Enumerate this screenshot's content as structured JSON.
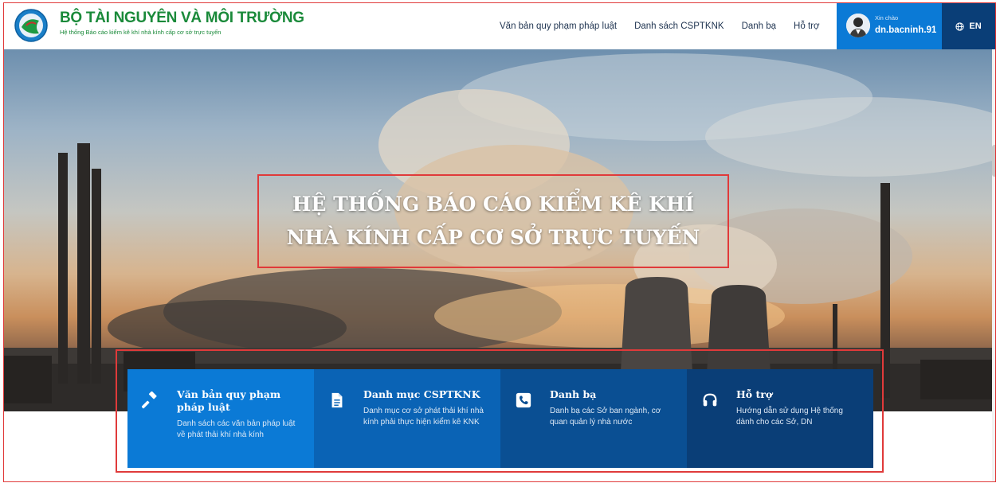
{
  "header": {
    "brand_title": "BỘ TÀI NGUYÊN VÀ MÔI TRƯỜNG",
    "brand_subtitle": "Hệ thống Báo cáo kiểm kê khí nhà kính cấp cơ sở trực tuyến",
    "nav": [
      {
        "label": "Văn bản quy phạm pháp luật"
      },
      {
        "label": "Danh sách CSPTKNK"
      },
      {
        "label": "Danh bạ"
      },
      {
        "label": "Hỗ trợ"
      }
    ],
    "user": {
      "greeting": "Xin chào",
      "name": "dn.bacninh.91"
    },
    "language": "EN"
  },
  "hero": {
    "title": "HỆ THỐNG BÁO CÁO KIỂM KÊ KHÍ NHÀ KÍNH CẤP CƠ SỞ TRỰC TUYẾN"
  },
  "cards": [
    {
      "icon": "gavel-icon",
      "title": "Văn bản quy phạm pháp luật",
      "desc": "Danh sách các văn bản pháp luật về phát thải khí nhà kính",
      "color": "#0b7ad6"
    },
    {
      "icon": "document-icon",
      "title": "Danh mục CSPTKNK",
      "desc": "Danh mục cơ sở phát thải khí nhà kính phải thực hiện kiểm kê KNK",
      "color": "#0a63b5"
    },
    {
      "icon": "phone-icon",
      "title": "Danh bạ",
      "desc": "Danh bạ các Sở ban ngành, cơ quan quản lý nhà nước",
      "color": "#0a4f93"
    },
    {
      "icon": "headset-icon",
      "title": "Hỗ trợ",
      "desc": "Hướng dẫn sử dụng Hệ thống dành cho các Sở, DN",
      "color": "#0a3e77"
    }
  ],
  "colors": {
    "brand_green": "#1a8a3a",
    "nav_text": "#1e3350",
    "highlight": "#e03a3a"
  }
}
